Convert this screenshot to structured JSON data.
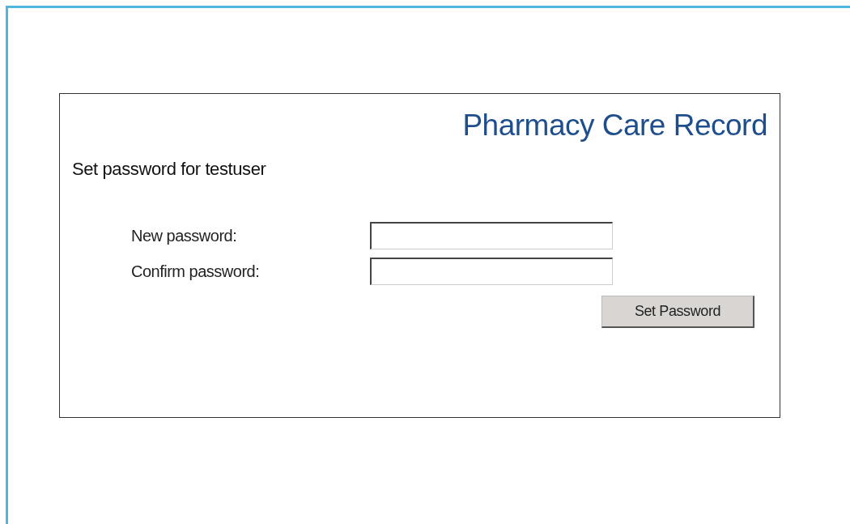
{
  "header": {
    "title": "Pharmacy Care Record"
  },
  "heading": "Set password for testuser",
  "fields": [
    {
      "label": "New password:"
    },
    {
      "label": "Confirm password:"
    }
  ],
  "button": "Set Password"
}
